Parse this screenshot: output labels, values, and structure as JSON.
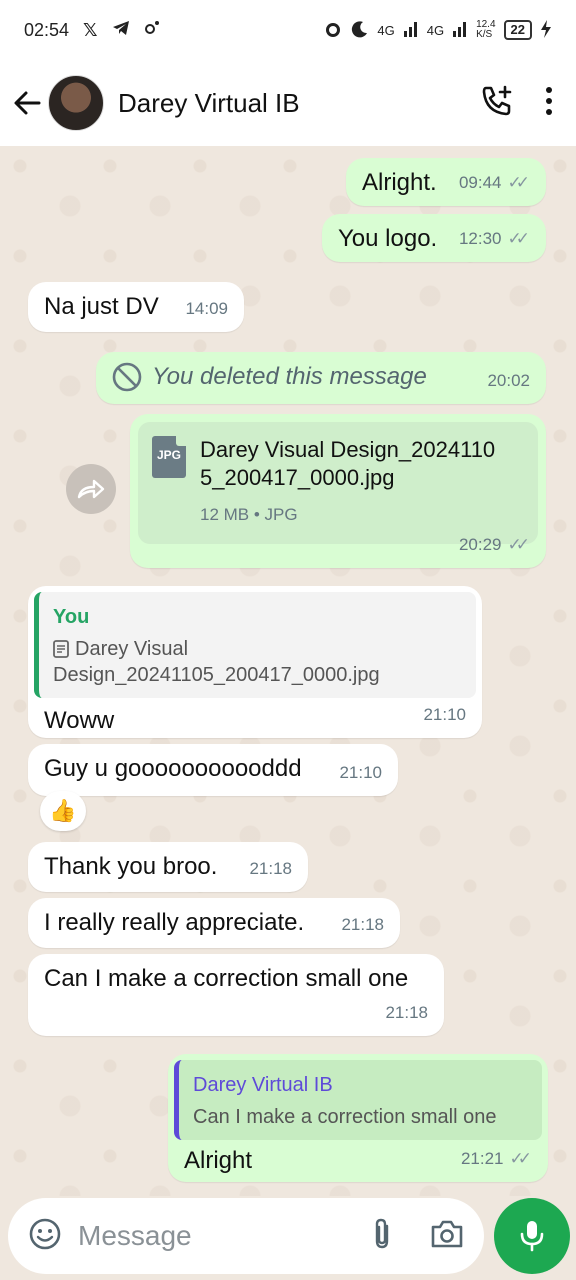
{
  "status_bar": {
    "time": "02:54",
    "network_1": "4G",
    "network_2": "4G",
    "speed": "12.4",
    "speed_unit": "K/S",
    "battery": "22"
  },
  "header": {
    "contact_name": "Darey Virtual IB"
  },
  "messages": [
    {
      "dir": "out",
      "text": "Alright.",
      "time": "09:44"
    },
    {
      "dir": "out",
      "text": "You logo.",
      "time": "12:30"
    },
    {
      "dir": "in",
      "text": "Na just DV",
      "time": "14:09"
    },
    {
      "dir": "out",
      "text": "You deleted this message",
      "time": "20:02",
      "deleted": true
    },
    {
      "dir": "out",
      "file": {
        "name": "Darey Visual Design_20241105_200417_0000.jpg",
        "name_line1": "Darey Visual Design_2024110",
        "name_line2": "5_200417_0000.jpg",
        "icon_label": "JPG",
        "meta": "12 MB • JPG"
      },
      "time": "20:29"
    },
    {
      "dir": "in",
      "quote": {
        "author": "You",
        "text": "Darey Visual Design_20241105_200417_0000.jpg",
        "text_line1": "Darey Visual",
        "text_line2": "Design_20241105_200417_0000.jpg"
      },
      "text": "Woww",
      "time": "21:10"
    },
    {
      "dir": "in",
      "text": "Guy u gooooooooooddd",
      "time": "21:10",
      "reaction": "👍"
    },
    {
      "dir": "in",
      "text": "Thank you broo.",
      "time": "21:18"
    },
    {
      "dir": "in",
      "text": "I really really appreciate.",
      "time": "21:18"
    },
    {
      "dir": "in",
      "text": "Can I make a correction small one",
      "time": "21:18"
    },
    {
      "dir": "out",
      "quote": {
        "author": "Darey Virtual IB",
        "text": "Can I make a correction small one"
      },
      "text": "Alright",
      "time": "21:21"
    }
  ],
  "composer": {
    "placeholder": "Message"
  },
  "colors": {
    "outgoing_bubble": "#d9fdd3",
    "incoming_bubble": "#ffffff",
    "accent_green": "#1da851",
    "chat_bg": "#efe7de"
  },
  "icons": {
    "back": "arrow-left-icon",
    "call": "phone-plus-icon",
    "menu": "more-vertical-icon",
    "emoji": "emoji-icon",
    "attach": "paperclip-icon",
    "camera": "camera-icon",
    "mic": "microphone-icon",
    "forward": "forward-icon",
    "deleted": "blocked-icon",
    "read": "double-check-icon"
  }
}
